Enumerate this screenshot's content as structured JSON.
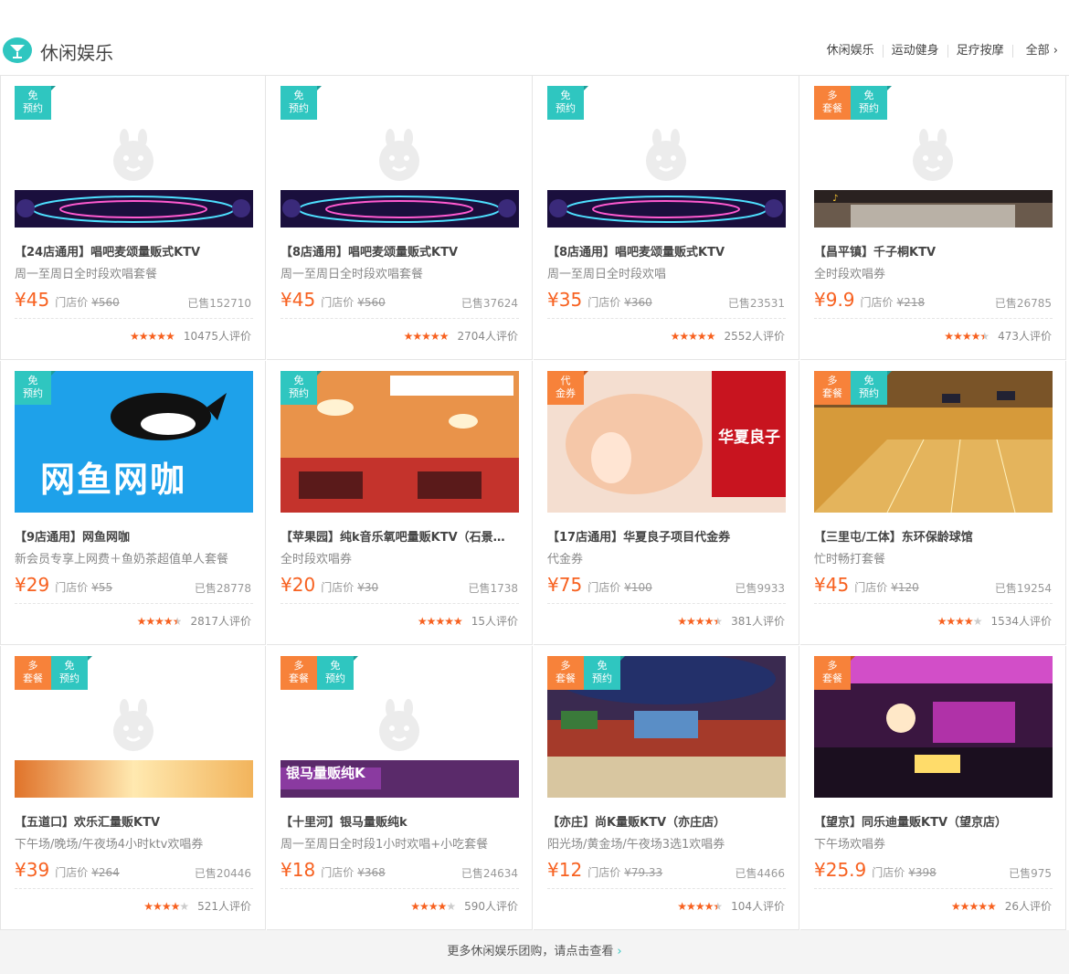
{
  "header": {
    "title": "休闲娱乐",
    "nav": [
      "休闲娱乐",
      "运动健身",
      "足疗按摩"
    ],
    "all_label": "全部 ›"
  },
  "colors": {
    "accent": "#2fc6c0",
    "price": "#f76120",
    "badge_orange": "#f7823a"
  },
  "cards": [
    {
      "badges": [
        {
          "text": "免\n预约",
          "color": "green"
        }
      ],
      "image": "ktv-banner-stars",
      "name": "【24店通用】唱吧麦颂量贩式KTV",
      "sub": "周一至周日全时段欢唱套餐",
      "price": "¥45",
      "orig_label": "门店价",
      "orig": "¥560",
      "sold": "已售152710",
      "rating": 5.0,
      "reviews": "10475人评价"
    },
    {
      "badges": [
        {
          "text": "免\n预约",
          "color": "green"
        }
      ],
      "image": "ktv-banner-stars",
      "name": "【8店通用】唱吧麦颂量贩式KTV",
      "sub": "周一至周日全时段欢唱套餐",
      "price": "¥45",
      "orig_label": "门店价",
      "orig": "¥560",
      "sold": "已售37624",
      "rating": 5.0,
      "reviews": "2704人评价"
    },
    {
      "badges": [
        {
          "text": "免\n预约",
          "color": "green"
        }
      ],
      "image": "ktv-banner-stars",
      "name": "【8店通用】唱吧麦颂量贩式KTV",
      "sub": "周一至周日全时段欢唱",
      "price": "¥35",
      "orig_label": "门店价",
      "orig": "¥360",
      "sold": "已售23531",
      "rating": 5.0,
      "reviews": "2552人评价"
    },
    {
      "badges": [
        {
          "text": "多\n套餐",
          "color": "orange"
        },
        {
          "text": "免\n预约",
          "color": "green"
        }
      ],
      "image": "ktv-storefront",
      "name": "【昌平镇】千子桐KTV",
      "sub": "全时段欢唱券",
      "price": "¥9.9",
      "orig_label": "门店价",
      "orig": "¥218",
      "sold": "已售26785",
      "rating": 4.5,
      "reviews": "473人评价"
    },
    {
      "badges": [
        {
          "text": "免\n预约",
          "color": "green"
        }
      ],
      "image": "netcafe-logo",
      "image_text": "网鱼网咖",
      "name": "【9店通用】网鱼网咖",
      "sub": "新会员专享上网费＋鱼奶茶超值单人套餐",
      "price": "¥29",
      "orig_label": "门店价",
      "orig": "¥55",
      "sold": "已售28778",
      "rating": 4.5,
      "reviews": "2817人评价"
    },
    {
      "badges": [
        {
          "text": "免\n预约",
          "color": "green"
        }
      ],
      "image": "ktv-room-orange",
      "name": "【苹果园】纯k音乐氧吧量贩KTV（石景…",
      "sub": "全时段欢唱券",
      "price": "¥20",
      "orig_label": "门店价",
      "orig": "¥30",
      "sold": "已售1738",
      "rating": 5.0,
      "reviews": "15人评价"
    },
    {
      "badges": [
        {
          "text": "代\n金券",
          "color": "orange"
        }
      ],
      "image": "massage-ad",
      "image_text": "华夏良子",
      "name": "【17店通用】华夏良子项目代金券",
      "sub": "代金券",
      "price": "¥75",
      "orig_label": "门店价",
      "orig": "¥100",
      "sold": "已售9933",
      "rating": 4.5,
      "reviews": "381人评价"
    },
    {
      "badges": [
        {
          "text": "多\n套餐",
          "color": "orange"
        },
        {
          "text": "免\n预约",
          "color": "green"
        }
      ],
      "image": "bowling-alley",
      "name": "【三里屯/工体】东环保龄球馆",
      "sub": "忙时畅打套餐",
      "price": "¥45",
      "orig_label": "门店价",
      "orig": "¥120",
      "sold": "已售19254",
      "rating": 4.0,
      "reviews": "1534人评价"
    },
    {
      "badges": [
        {
          "text": "多\n套餐",
          "color": "orange"
        },
        {
          "text": "免\n预约",
          "color": "green"
        }
      ],
      "image": "ktv-banner-gold",
      "name": "【五道口】欢乐汇量贩KTV",
      "sub": "下午场/晚场/午夜场4小时ktv欢唱券",
      "price": "¥39",
      "orig_label": "门店价",
      "orig": "¥264",
      "sold": "已售20446",
      "rating": 4.0,
      "reviews": "521人评价"
    },
    {
      "badges": [
        {
          "text": "多\n套餐",
          "color": "orange"
        },
        {
          "text": "免\n预约",
          "color": "green"
        }
      ],
      "image": "ktv-banner-purple",
      "image_text": "银马量贩纯K",
      "name": "【十里河】银马量贩纯k",
      "sub": "周一至周日全时段1小时欢唱+小吃套餐",
      "price": "¥18",
      "orig_label": "门店价",
      "orig": "¥368",
      "sold": "已售24634",
      "rating": 4.0,
      "reviews": "590人评价"
    },
    {
      "badges": [
        {
          "text": "多\n套餐",
          "color": "orange"
        },
        {
          "text": "免\n预约",
          "color": "green"
        }
      ],
      "image": "ktv-room-cartoon",
      "name": "【亦庄】尚K量贩KTV（亦庄店）",
      "sub": "阳光场/黄金场/午夜场3选1欢唱券",
      "price": "¥12",
      "orig_label": "门店价",
      "orig": "¥79.33",
      "sold": "已售4466",
      "rating": 4.5,
      "reviews": "104人评价"
    },
    {
      "badges": [
        {
          "text": "多\n套餐",
          "color": "orange"
        }
      ],
      "image": "ktv-room-pink",
      "name": "【望京】同乐迪量贩KTV（望京店）",
      "sub": "下午场欢唱券",
      "price": "¥25.9",
      "orig_label": "门店价",
      "orig": "¥398",
      "sold": "已售975",
      "rating": 5.0,
      "reviews": "26人评价"
    }
  ],
  "footer": {
    "text": "更多休闲娱乐团购，请点击查看",
    "arrow": "›"
  }
}
